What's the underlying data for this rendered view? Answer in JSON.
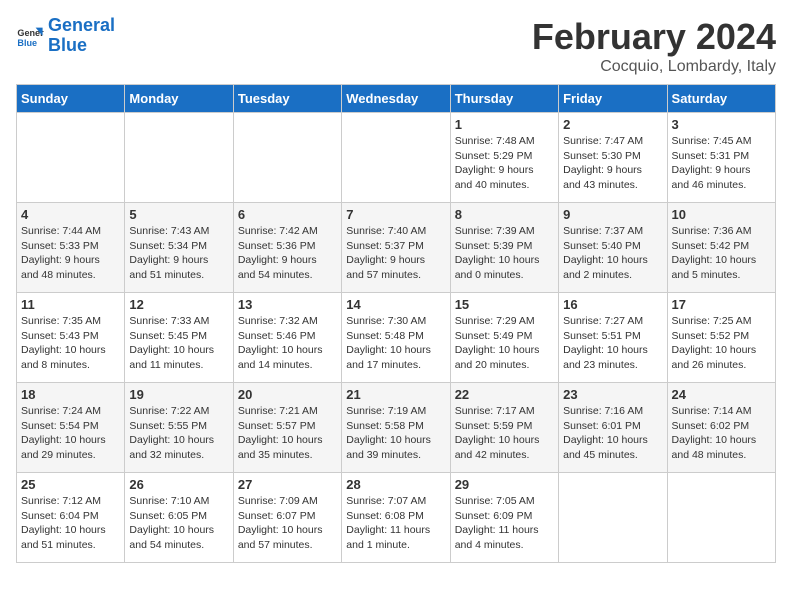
{
  "header": {
    "logo_line1": "General",
    "logo_line2": "Blue",
    "title": "February 2024",
    "subtitle": "Cocquio, Lombardy, Italy"
  },
  "columns": [
    "Sunday",
    "Monday",
    "Tuesday",
    "Wednesday",
    "Thursday",
    "Friday",
    "Saturday"
  ],
  "weeks": [
    [
      {
        "day": "",
        "info": ""
      },
      {
        "day": "",
        "info": ""
      },
      {
        "day": "",
        "info": ""
      },
      {
        "day": "",
        "info": ""
      },
      {
        "day": "1",
        "info": "Sunrise: 7:48 AM\nSunset: 5:29 PM\nDaylight: 9 hours\nand 40 minutes."
      },
      {
        "day": "2",
        "info": "Sunrise: 7:47 AM\nSunset: 5:30 PM\nDaylight: 9 hours\nand 43 minutes."
      },
      {
        "day": "3",
        "info": "Sunrise: 7:45 AM\nSunset: 5:31 PM\nDaylight: 9 hours\nand 46 minutes."
      }
    ],
    [
      {
        "day": "4",
        "info": "Sunrise: 7:44 AM\nSunset: 5:33 PM\nDaylight: 9 hours\nand 48 minutes."
      },
      {
        "day": "5",
        "info": "Sunrise: 7:43 AM\nSunset: 5:34 PM\nDaylight: 9 hours\nand 51 minutes."
      },
      {
        "day": "6",
        "info": "Sunrise: 7:42 AM\nSunset: 5:36 PM\nDaylight: 9 hours\nand 54 minutes."
      },
      {
        "day": "7",
        "info": "Sunrise: 7:40 AM\nSunset: 5:37 PM\nDaylight: 9 hours\nand 57 minutes."
      },
      {
        "day": "8",
        "info": "Sunrise: 7:39 AM\nSunset: 5:39 PM\nDaylight: 10 hours\nand 0 minutes."
      },
      {
        "day": "9",
        "info": "Sunrise: 7:37 AM\nSunset: 5:40 PM\nDaylight: 10 hours\nand 2 minutes."
      },
      {
        "day": "10",
        "info": "Sunrise: 7:36 AM\nSunset: 5:42 PM\nDaylight: 10 hours\nand 5 minutes."
      }
    ],
    [
      {
        "day": "11",
        "info": "Sunrise: 7:35 AM\nSunset: 5:43 PM\nDaylight: 10 hours\nand 8 minutes."
      },
      {
        "day": "12",
        "info": "Sunrise: 7:33 AM\nSunset: 5:45 PM\nDaylight: 10 hours\nand 11 minutes."
      },
      {
        "day": "13",
        "info": "Sunrise: 7:32 AM\nSunset: 5:46 PM\nDaylight: 10 hours\nand 14 minutes."
      },
      {
        "day": "14",
        "info": "Sunrise: 7:30 AM\nSunset: 5:48 PM\nDaylight: 10 hours\nand 17 minutes."
      },
      {
        "day": "15",
        "info": "Sunrise: 7:29 AM\nSunset: 5:49 PM\nDaylight: 10 hours\nand 20 minutes."
      },
      {
        "day": "16",
        "info": "Sunrise: 7:27 AM\nSunset: 5:51 PM\nDaylight: 10 hours\nand 23 minutes."
      },
      {
        "day": "17",
        "info": "Sunrise: 7:25 AM\nSunset: 5:52 PM\nDaylight: 10 hours\nand 26 minutes."
      }
    ],
    [
      {
        "day": "18",
        "info": "Sunrise: 7:24 AM\nSunset: 5:54 PM\nDaylight: 10 hours\nand 29 minutes."
      },
      {
        "day": "19",
        "info": "Sunrise: 7:22 AM\nSunset: 5:55 PM\nDaylight: 10 hours\nand 32 minutes."
      },
      {
        "day": "20",
        "info": "Sunrise: 7:21 AM\nSunset: 5:57 PM\nDaylight: 10 hours\nand 35 minutes."
      },
      {
        "day": "21",
        "info": "Sunrise: 7:19 AM\nSunset: 5:58 PM\nDaylight: 10 hours\nand 39 minutes."
      },
      {
        "day": "22",
        "info": "Sunrise: 7:17 AM\nSunset: 5:59 PM\nDaylight: 10 hours\nand 42 minutes."
      },
      {
        "day": "23",
        "info": "Sunrise: 7:16 AM\nSunset: 6:01 PM\nDaylight: 10 hours\nand 45 minutes."
      },
      {
        "day": "24",
        "info": "Sunrise: 7:14 AM\nSunset: 6:02 PM\nDaylight: 10 hours\nand 48 minutes."
      }
    ],
    [
      {
        "day": "25",
        "info": "Sunrise: 7:12 AM\nSunset: 6:04 PM\nDaylight: 10 hours\nand 51 minutes."
      },
      {
        "day": "26",
        "info": "Sunrise: 7:10 AM\nSunset: 6:05 PM\nDaylight: 10 hours\nand 54 minutes."
      },
      {
        "day": "27",
        "info": "Sunrise: 7:09 AM\nSunset: 6:07 PM\nDaylight: 10 hours\nand 57 minutes."
      },
      {
        "day": "28",
        "info": "Sunrise: 7:07 AM\nSunset: 6:08 PM\nDaylight: 11 hours\nand 1 minute."
      },
      {
        "day": "29",
        "info": "Sunrise: 7:05 AM\nSunset: 6:09 PM\nDaylight: 11 hours\nand 4 minutes."
      },
      {
        "day": "",
        "info": ""
      },
      {
        "day": "",
        "info": ""
      }
    ]
  ]
}
